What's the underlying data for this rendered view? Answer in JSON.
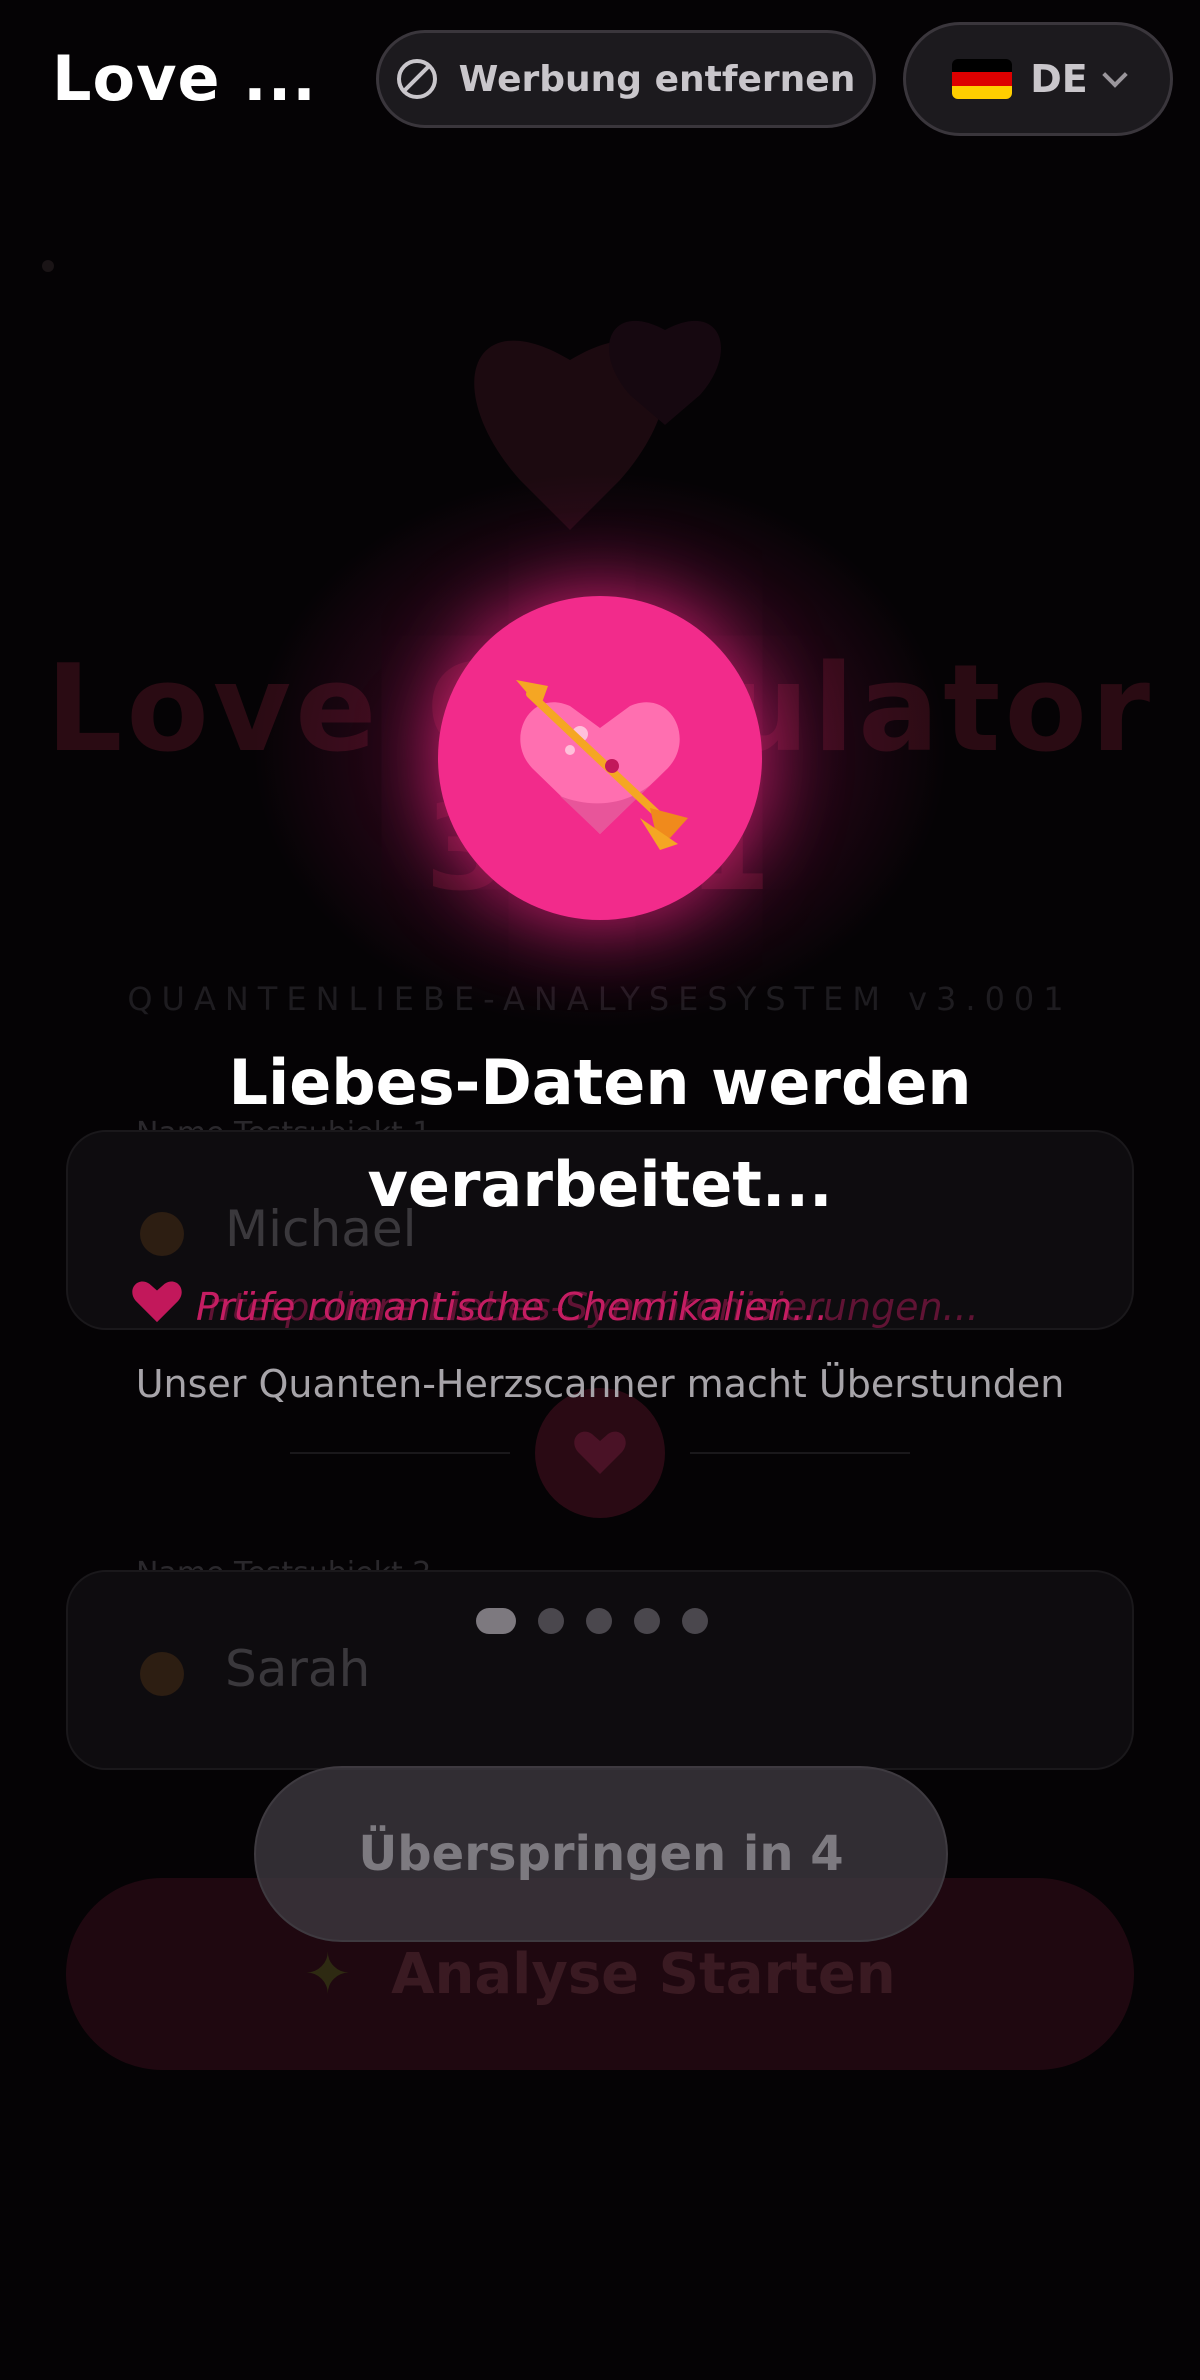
{
  "header": {
    "app_title": "Love ...",
    "remove_ads_label": "Werbung entfernen",
    "language": {
      "code": "DE",
      "flag": "german-flag"
    }
  },
  "background_page": {
    "title": "Love Calculator 3001",
    "subtitle": "QUANTENLIEBE-ANALYSESYSTEM v3.001",
    "subject1": {
      "label": "Name Testsubjekt 1",
      "value": "Michael"
    },
    "subject2": {
      "label": "Name Testsubjekt 2",
      "value": "Sarah"
    },
    "start_button_label": "Analyse Starten"
  },
  "overlay": {
    "title": "Liebes-Daten werden verarbeitet...",
    "status_message": "Prüfe romantische Chemikalien...",
    "status_message_transition": "Interpoliere Liebes-Synchronisierungen...",
    "subtext": "Unser Quanten-Herzscanner macht Überstunden",
    "progress_steps": 5,
    "active_step": 1,
    "skip_button_label": "Überspringen in 4"
  },
  "colors": {
    "accent_pink": "#f22b8b",
    "background": "#050305",
    "status_text": "#c41d62"
  }
}
